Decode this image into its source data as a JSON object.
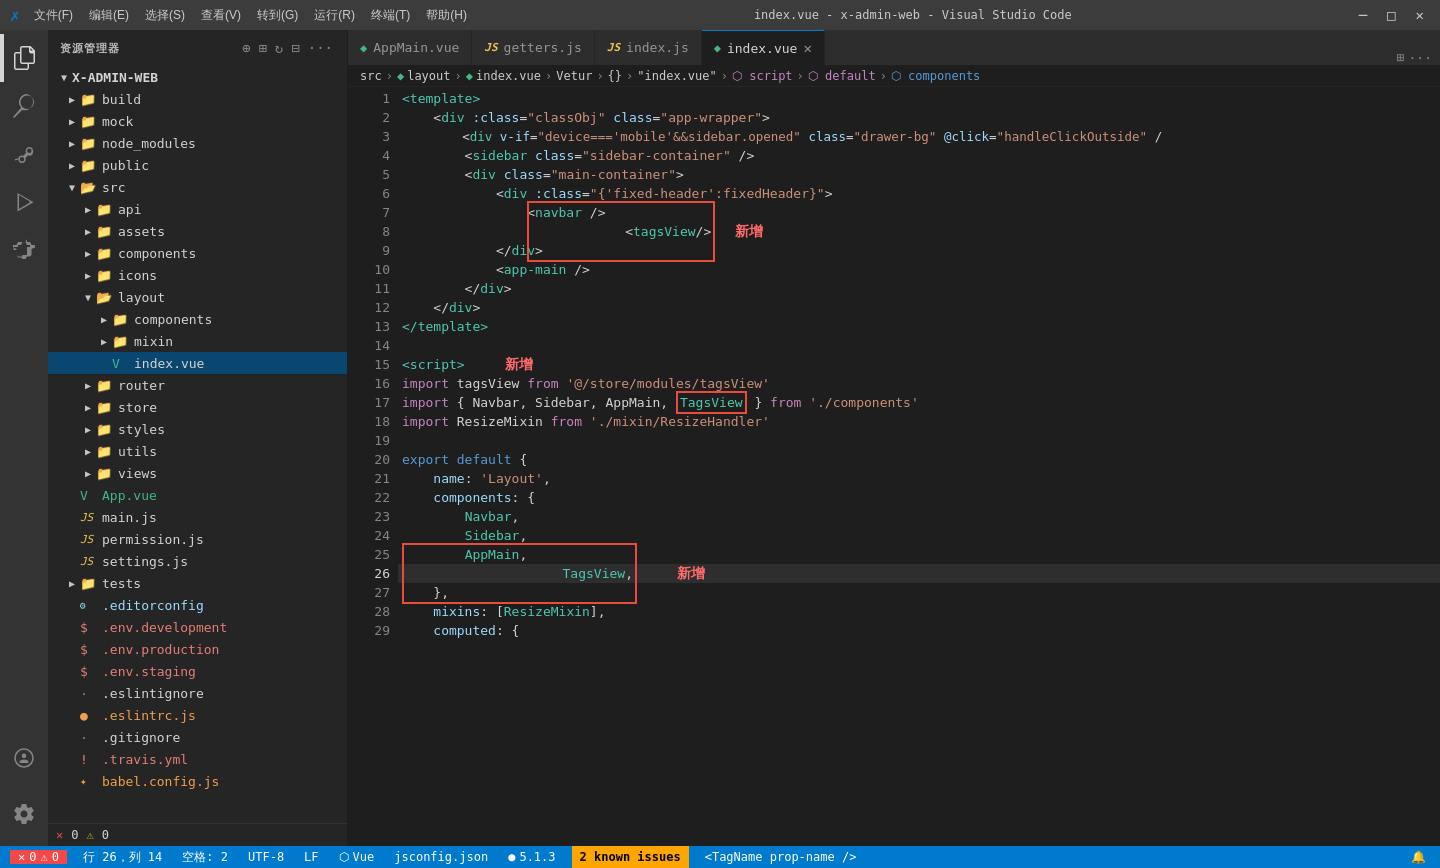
{
  "titleBar": {
    "icon": "✗",
    "menus": [
      "文件(F)",
      "编辑(E)",
      "选择(S)",
      "查看(V)",
      "转到(G)",
      "运行(R)",
      "终端(T)",
      "帮助(H)"
    ],
    "title": "index.vue - x-admin-web - Visual Studio Code",
    "windowControls": [
      "⊟",
      "❐",
      "✕"
    ]
  },
  "tabs": [
    {
      "id": "AppMain",
      "icon": "vue",
      "label": "AppMain.vue",
      "active": false
    },
    {
      "id": "getters",
      "icon": "js",
      "label": "getters.js",
      "active": false
    },
    {
      "id": "index_js",
      "icon": "js",
      "label": "index.js",
      "active": false
    },
    {
      "id": "index_vue",
      "icon": "vue",
      "label": "index.vue",
      "active": true,
      "closable": true
    }
  ],
  "breadcrumb": [
    "src",
    "layout",
    "index.vue",
    "Vetur",
    "{}",
    "\"index.vue\"",
    "script",
    "default",
    "components"
  ],
  "sidebar": {
    "title": "资源管理器",
    "rootName": "X-ADMIN-WEB",
    "files": [
      {
        "indent": 1,
        "type": "folder",
        "label": "build",
        "open": false
      },
      {
        "indent": 1,
        "type": "folder",
        "label": "mock",
        "open": false
      },
      {
        "indent": 1,
        "type": "folder",
        "label": "node_modules",
        "open": false
      },
      {
        "indent": 1,
        "type": "folder",
        "label": "public",
        "open": false
      },
      {
        "indent": 1,
        "type": "folder",
        "label": "src",
        "open": true
      },
      {
        "indent": 2,
        "type": "folder",
        "label": "api",
        "open": false
      },
      {
        "indent": 2,
        "type": "folder",
        "label": "assets",
        "open": false
      },
      {
        "indent": 2,
        "type": "folder",
        "label": "components",
        "open": false
      },
      {
        "indent": 2,
        "type": "folder",
        "label": "icons",
        "open": false
      },
      {
        "indent": 2,
        "type": "folder",
        "label": "layout",
        "open": true
      },
      {
        "indent": 3,
        "type": "folder",
        "label": "components",
        "open": false
      },
      {
        "indent": 3,
        "type": "folder",
        "label": "mixin",
        "open": false
      },
      {
        "indent": 3,
        "type": "vue",
        "label": "index.vue",
        "open": false,
        "active": true
      },
      {
        "indent": 2,
        "type": "folder",
        "label": "router",
        "open": false
      },
      {
        "indent": 2,
        "type": "folder",
        "label": "store",
        "open": false
      },
      {
        "indent": 2,
        "type": "folder",
        "label": "styles",
        "open": false
      },
      {
        "indent": 2,
        "type": "folder",
        "label": "utils",
        "open": false
      },
      {
        "indent": 2,
        "type": "folder",
        "label": "views",
        "open": false
      },
      {
        "indent": 1,
        "type": "vue",
        "label": "App.vue",
        "open": false
      },
      {
        "indent": 1,
        "type": "js",
        "label": "main.js",
        "open": false
      },
      {
        "indent": 1,
        "type": "js",
        "label": "permission.js",
        "open": false
      },
      {
        "indent": 1,
        "type": "js",
        "label": "settings.js",
        "open": false
      },
      {
        "indent": 1,
        "type": "folder",
        "label": "tests",
        "open": false
      },
      {
        "indent": 1,
        "type": "editorconfig",
        "label": ".editorconfig",
        "open": false
      },
      {
        "indent": 1,
        "type": "env",
        "label": ".env.development",
        "open": false
      },
      {
        "indent": 1,
        "type": "env",
        "label": ".env.production",
        "open": false
      },
      {
        "indent": 1,
        "type": "env",
        "label": ".env.staging",
        "open": false
      },
      {
        "indent": 1,
        "type": "text",
        "label": ".eslintignore",
        "open": false
      },
      {
        "indent": 1,
        "type": "eslint",
        "label": ".eslintrc.js",
        "open": false
      },
      {
        "indent": 1,
        "type": "git",
        "label": ".gitignore",
        "open": false
      },
      {
        "indent": 1,
        "type": "travis",
        "label": ".travis.yml",
        "open": false
      },
      {
        "indent": 1,
        "type": "babel",
        "label": "babel.config.js",
        "open": false
      }
    ]
  },
  "statusBar": {
    "errorsCount": "0",
    "warningsCount": "0",
    "position": "行 26，列 14",
    "spaces": "空格: 2",
    "encoding": "UTF-8",
    "lineEnding": "LF",
    "language": "Vue",
    "schema": "jsconfig.json",
    "eslintVersion": "5.1.3",
    "knownIssues": "2 known issues",
    "tagName": "<TagName prop-name />"
  },
  "codeLines": [
    {
      "num": 1,
      "content": "<template>"
    },
    {
      "num": 2,
      "content": "    <div :class=\"classObj\" class=\"app-wrapper\">"
    },
    {
      "num": 3,
      "content": "        <div v-if=\"device==='mobile'&&sidebar.opened\" class=\"drawer-bg\" @click=\"handleClickOutside\" /"
    },
    {
      "num": 4,
      "content": "        <sidebar class=\"sidebar-container\" />"
    },
    {
      "num": 5,
      "content": "        <div class=\"main-container\">"
    },
    {
      "num": 6,
      "content": "            <div :class=\"{'fixed-header':fixedHeader}\">"
    },
    {
      "num": 7,
      "content": "                <navbar />"
    },
    {
      "num": 8,
      "content": "                <tagsView/>",
      "highlight": true,
      "annotation": "新增"
    },
    {
      "num": 9,
      "content": "            </div>"
    },
    {
      "num": 10,
      "content": "            <app-main />"
    },
    {
      "num": 11,
      "content": "        </div>"
    },
    {
      "num": 12,
      "content": "    </div>"
    },
    {
      "num": 13,
      "content": "</template>"
    },
    {
      "num": 14,
      "content": ""
    },
    {
      "num": 15,
      "content": "<script>"
    },
    {
      "num": 16,
      "content": "import tagsView from '@/store/modules/tagsView'"
    },
    {
      "num": 17,
      "content": "import { Navbar, Sidebar, AppMain, TagsView } from './components'"
    },
    {
      "num": 18,
      "content": "import ResizeMixin from './mixin/ResizeHandler'"
    },
    {
      "num": 19,
      "content": ""
    },
    {
      "num": 20,
      "content": "export default {"
    },
    {
      "num": 21,
      "content": "    name: 'Layout',"
    },
    {
      "num": 22,
      "content": "    components: {"
    },
    {
      "num": 23,
      "content": "        Navbar,"
    },
    {
      "num": 24,
      "content": "        Sidebar,"
    },
    {
      "num": 25,
      "content": "        AppMain,"
    },
    {
      "num": 26,
      "content": "        TagsView,",
      "highlight": true,
      "annotation": "新增",
      "active": true
    },
    {
      "num": 27,
      "content": "    },"
    },
    {
      "num": 28,
      "content": "    mixins: [ResizeMixin],"
    },
    {
      "num": 29,
      "content": "    computed: {"
    }
  ]
}
